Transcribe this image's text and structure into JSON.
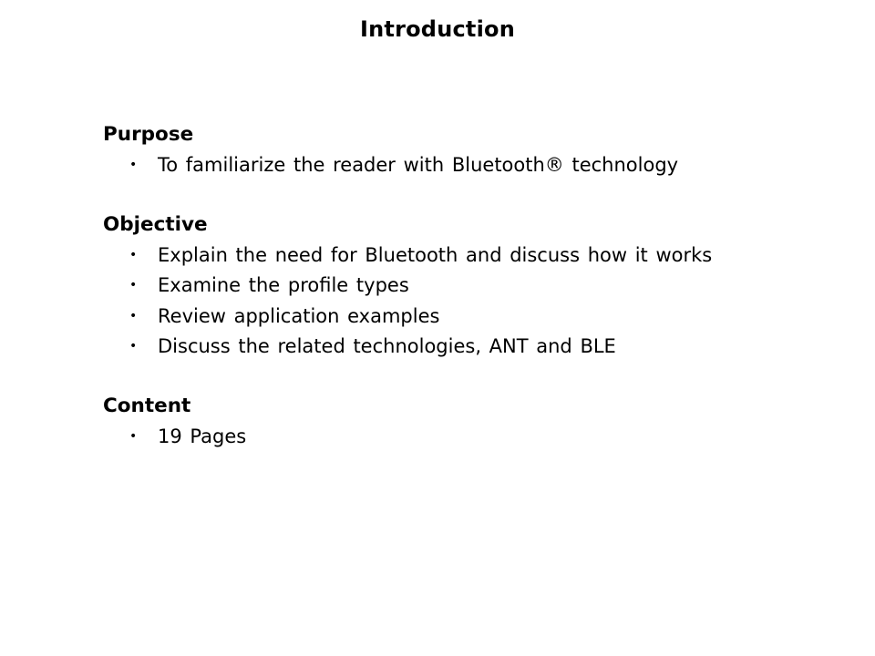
{
  "slide": {
    "title": "Introduction",
    "bullet_glyph": "•",
    "sections": [
      {
        "heading": "Purpose",
        "bullets": [
          "To familiarize the reader with Bluetooth® technology"
        ]
      },
      {
        "heading": "Objective",
        "bullets": [
          "Explain the need for Bluetooth and discuss how it works",
          "Examine the profile types",
          "Review application examples",
          "Discuss the related technologies, ANT and BLE"
        ]
      },
      {
        "heading": "Content",
        "bullets": [
          "19 Pages"
        ]
      }
    ]
  }
}
